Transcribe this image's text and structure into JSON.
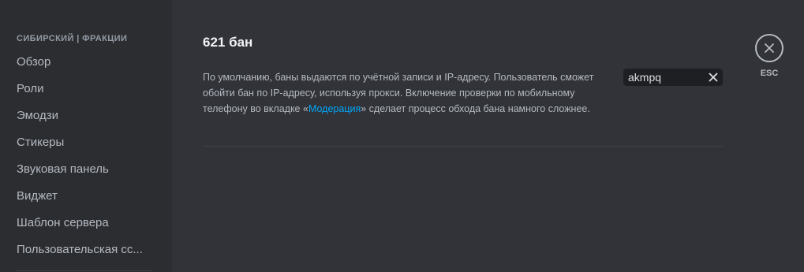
{
  "sidebar": {
    "header": "СИБИРСКИЙ | ФРАКЦИИ",
    "items": [
      {
        "label": "Обзор"
      },
      {
        "label": "Роли"
      },
      {
        "label": "Эмодзи"
      },
      {
        "label": "Стикеры"
      },
      {
        "label": "Звуковая панель"
      },
      {
        "label": "Виджет"
      },
      {
        "label": "Шаблон сервера"
      },
      {
        "label": "Пользовательская сс..."
      }
    ]
  },
  "main": {
    "title": "621 бан",
    "description_part1": "По умолчанию, баны выдаются по учётной записи и IP-адресу. Пользователь сможет обойти бан по IP-адресу, используя прокси. Включение проверки по мобильному телефону во вкладке «",
    "description_link": "Модерация",
    "description_part2": "» сделает процесс обхода бана намного сложнее.",
    "search": {
      "value": "akmpq",
      "clear_icon": "close-icon"
    }
  },
  "esc": {
    "label": "ESC",
    "icon": "close-icon"
  },
  "colors": {
    "sidebar_bg": "#2b2d31",
    "content_bg": "#313338",
    "link": "#00a8fc",
    "input_bg": "#1e1f22"
  }
}
